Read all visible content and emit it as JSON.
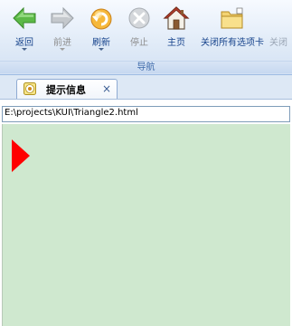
{
  "ribbon": {
    "group_label": "导航",
    "buttons": [
      {
        "label": "返回",
        "icon": "back-arrow-icon",
        "enabled": true,
        "dropdown": true
      },
      {
        "label": "前进",
        "icon": "forward-arrow-icon",
        "enabled": false,
        "dropdown": true
      },
      {
        "label": "刷新",
        "icon": "refresh-icon",
        "enabled": true,
        "dropdown": true
      },
      {
        "label": "停止",
        "icon": "stop-icon",
        "enabled": false,
        "dropdown": false
      },
      {
        "label": "主页",
        "icon": "home-icon",
        "enabled": true,
        "dropdown": false
      },
      {
        "label": "关闭所有选项卡",
        "icon": "folder-close-tabs-icon",
        "enabled": true,
        "dropdown": false
      },
      {
        "label": "关闭",
        "icon": "close-icon",
        "enabled": true,
        "dropdown": false
      }
    ]
  },
  "tabs": [
    {
      "label": "提示信息",
      "icon": "info-badge-icon",
      "active": true,
      "close_glyph": "×"
    }
  ],
  "content": {
    "address": "E:\\projects\\KUI\\Triangle2.html",
    "page_background": "#cfe8cf",
    "shape": {
      "type": "triangle",
      "direction": "right",
      "color": "#ff0000"
    }
  },
  "colors": {
    "accent": "#15428b",
    "green_arrow": "#58b13d",
    "orange_refresh": "#f0a020"
  }
}
